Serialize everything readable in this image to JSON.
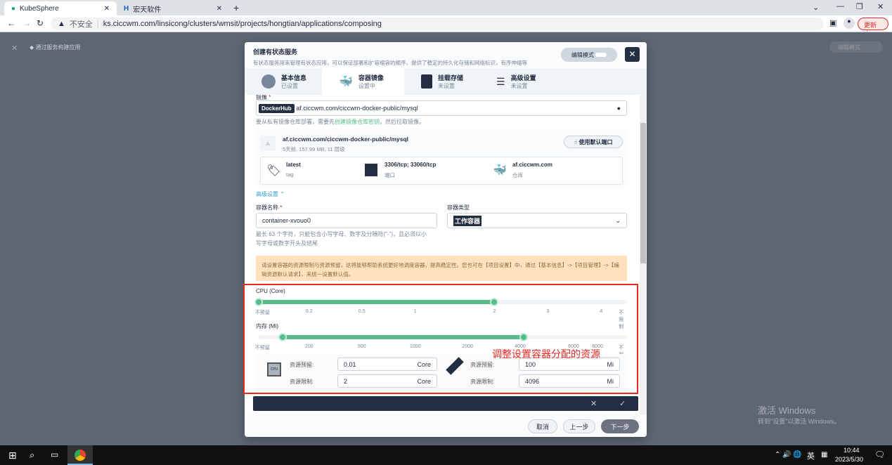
{
  "browser": {
    "tabs": [
      {
        "label": "KubeSphere"
      },
      {
        "label": "宏天软件"
      }
    ],
    "new_tab": "+",
    "security": "不安全",
    "url": "ks.ciccwm.com/linsicong/clusters/wmsit/projects/hongtian/applications/composing",
    "update_label": "更新"
  },
  "page": {
    "breadcrumb": "通过服务构建应用",
    "edit_mode": "编辑模式"
  },
  "modal": {
    "title": "创建有状态服务",
    "subtitle": "有状态服务用来管理有状态应用，可以保证部署和扩容缩容的顺序，提供了稳定的持久化存储和网络标识，有序伸缩等",
    "edit_mode": "编辑模式",
    "steps": [
      {
        "title": "基本信息",
        "status": "已设置"
      },
      {
        "title": "容器镜像",
        "status": "设置中"
      },
      {
        "title": "挂载存储",
        "status": "未设置"
      },
      {
        "title": "高级设置",
        "status": "未设置"
      }
    ],
    "image_label": "镜像",
    "registry_badge": "DockerHub",
    "image_value": "af.ciccwm.com/ciccwm-docker-public/mysql",
    "image_hint_pre": "要从私有镜像仓库部署，需要先",
    "image_hint_link": "创建镜像仓库密钥",
    "image_hint_post": "，然后拉取镜像。",
    "image_card": {
      "name": "af.ciccwm.com/ciccwm-docker-public/mysql",
      "meta": "5天前, 157.99 MB, 11 层级",
      "use_default_ports": "使用默认端口",
      "tag_value": "latest",
      "tag_label": "tag",
      "ports_value": "3306/tcp; 33060/tcp",
      "ports_label": "端口",
      "repo_value": "af.ciccwm.com",
      "repo_label": "仓库"
    },
    "advanced_toggle": "高级设置",
    "container_name_label": "容器名称",
    "container_name_value": "container-xvouo0",
    "container_name_hint": "最长 63 个字符，只能包含小写字母、数字及分隔符(\"-\")，且必须以小写字母或数字开头及结尾",
    "container_type_label": "容器类型",
    "container_type_value": "工作容器",
    "warning": "请设置容器的资源限制与资源预留，这将能够帮助系统更好地调度容器，提高稳定性。您也可在【项目设置】中，通过【基本信息】->【项目管理】->【编辑资源默认请求】，来统一设置默认值。",
    "cpu": {
      "label": "CPU (Core)",
      "ticks": [
        "不预留",
        "0.2",
        "0.5",
        "1",
        "2",
        "3",
        "4",
        "不限制"
      ],
      "reserve_fraction": 0,
      "limit_fraction": 0.64
    },
    "memory": {
      "label": "内存 (Mi)",
      "ticks": [
        "不预留",
        "200",
        "500",
        "1000",
        "2000",
        "4000",
        "6000",
        "8000",
        "不限制"
      ],
      "reserve_fraction": 0.065,
      "limit_fraction": 0.72
    },
    "resources": {
      "cpu_icon_text": "CPU",
      "reserve_label": "资源预留:",
      "limit_label": "资源限制:",
      "cpu_reserve": "0.01",
      "cpu_limit": "2",
      "cpu_unit": "Core",
      "mem_reserve": "100",
      "mem_limit": "4096",
      "mem_unit": "Mi"
    },
    "annotation": "调整设置容器分配的资源",
    "footer": {
      "cancel": "取消",
      "prev": "上一步",
      "next": "下一步"
    }
  },
  "windows": {
    "activate_title": "激活 Windows",
    "activate_sub": "转到\"设置\"以激活 Windows。",
    "ime": "英",
    "time": "10:44",
    "date": "2023/5/30"
  }
}
